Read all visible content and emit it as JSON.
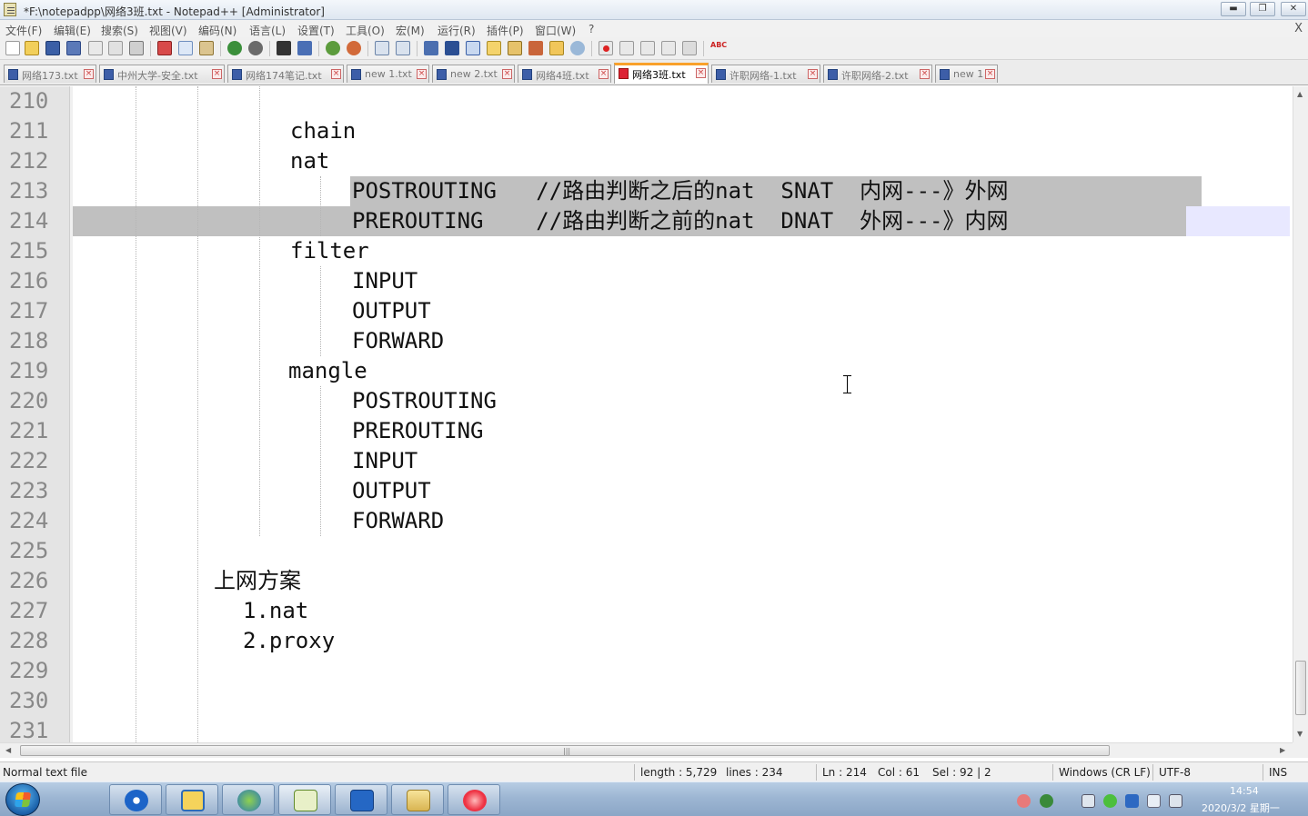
{
  "window": {
    "title": "*F:\\notepadpp\\网络3班.txt - Notepad++ [Administrator]",
    "controls": {
      "minimize": "▬",
      "maximize": "❐",
      "close": "✕"
    }
  },
  "menu": {
    "items": [
      "文件(F)",
      "编辑(E)",
      "搜索(S)",
      "视图(V)",
      "编码(N)",
      "语言(L)",
      "设置(T)",
      "工具(O)",
      "宏(M)",
      "运行(R)",
      "插件(P)",
      "窗口(W)",
      "?"
    ],
    "close_doc": "X"
  },
  "toolbar": {
    "icons": [
      "new-file-icon",
      "open-file-icon",
      "save-icon",
      "save-all-icon",
      "close-icon",
      "close-all-icon",
      "print-icon",
      "cut-icon",
      "copy-icon",
      "paste-icon",
      "undo-icon",
      "redo-icon",
      "find-icon",
      "replace-icon",
      "zoom-in-icon",
      "zoom-out-icon",
      "sync-vertical-icon",
      "sync-horizontal-icon",
      "word-wrap-icon",
      "show-all-chars-icon",
      "indent-guide-icon",
      "language-icon",
      "doc-map-icon",
      "function-list-icon",
      "folder-workspace-icon",
      "monitoring-icon",
      "record-macro-icon",
      "stop-macro-icon",
      "play-macro-icon",
      "run-macro-multiple-icon",
      "save-macro-icon",
      "spellcheck-icon"
    ],
    "spell_label": "ABC"
  },
  "tabs": [
    {
      "label": "网络173.txt",
      "active": false
    },
    {
      "label": "中州大学-安全.txt",
      "active": false
    },
    {
      "label": "网络174笔记.txt",
      "active": false
    },
    {
      "label": "new 1.txt",
      "active": false
    },
    {
      "label": "new 2.txt",
      "active": false
    },
    {
      "label": "网络4班.txt",
      "active": false
    },
    {
      "label": "网络3班.txt",
      "active": true
    },
    {
      "label": "许职网络-1.txt",
      "active": false
    },
    {
      "label": "许职网络-2.txt",
      "active": false
    },
    {
      "label": "new 1",
      "active": false
    }
  ],
  "editor": {
    "lines": [
      {
        "num": "210",
        "text": ""
      },
      {
        "num": "211",
        "text": "chain"
      },
      {
        "num": "212",
        "text": "nat"
      },
      {
        "num": "213",
        "text": "POSTROUTING   //路由判断之后的nat  SNAT  内网---》外网"
      },
      {
        "num": "214",
        "text": "PREROUTING    //路由判断之前的nat  DNAT  外网---》内网"
      },
      {
        "num": "215",
        "text": "filter"
      },
      {
        "num": "216",
        "text": "INPUT"
      },
      {
        "num": "217",
        "text": "OUTPUT"
      },
      {
        "num": "218",
        "text": "FORWARD"
      },
      {
        "num": "219",
        "text": "mangle"
      },
      {
        "num": "220",
        "text": "POSTROUTING"
      },
      {
        "num": "221",
        "text": "PREROUTING"
      },
      {
        "num": "222",
        "text": "INPUT"
      },
      {
        "num": "223",
        "text": "OUTPUT"
      },
      {
        "num": "224",
        "text": "FORWARD"
      },
      {
        "num": "225",
        "text": ""
      },
      {
        "num": "226",
        "text": "上网方案"
      },
      {
        "num": "227",
        "text": "1.nat"
      },
      {
        "num": "228",
        "text": "2.proxy"
      },
      {
        "num": "229",
        "text": ""
      },
      {
        "num": "230",
        "text": ""
      },
      {
        "num": "231",
        "text": ""
      }
    ]
  },
  "scrollbars": {
    "up": "▲",
    "down": "▼",
    "left": "◀",
    "right": "▶",
    "grip": "|||"
  },
  "status": {
    "file_type": "Normal text file",
    "length": "length : 5,729",
    "lines": "lines : 234",
    "ln": "Ln : 214",
    "col": "Col : 61",
    "sel": "Sel : 92 | 2",
    "eol": "Windows (CR LF)",
    "encoding": "UTF-8",
    "mode": "INS"
  },
  "taskbar": {
    "apps": [
      "vpn-client-icon",
      "file-manager-icon",
      "network-tool-icon",
      "notepadpp-icon",
      "video-recorder-icon",
      "explorer-icon",
      "snail-app-icon"
    ],
    "tray_icons": [
      "tray-app-1-icon",
      "tray-app-2-icon",
      "tray-network-icon",
      "tray-update-icon",
      "tray-flag-icon",
      "tray-volume-icon",
      "tray-display-icon"
    ],
    "time": "14:54",
    "date": "2020/3/2 星期一"
  },
  "colors": {
    "selection": "#c0c0c0",
    "current_line": "#e8e8ff",
    "active_tab_accent": "#f9a12b",
    "gutter_bg": "#e4e4e4"
  }
}
